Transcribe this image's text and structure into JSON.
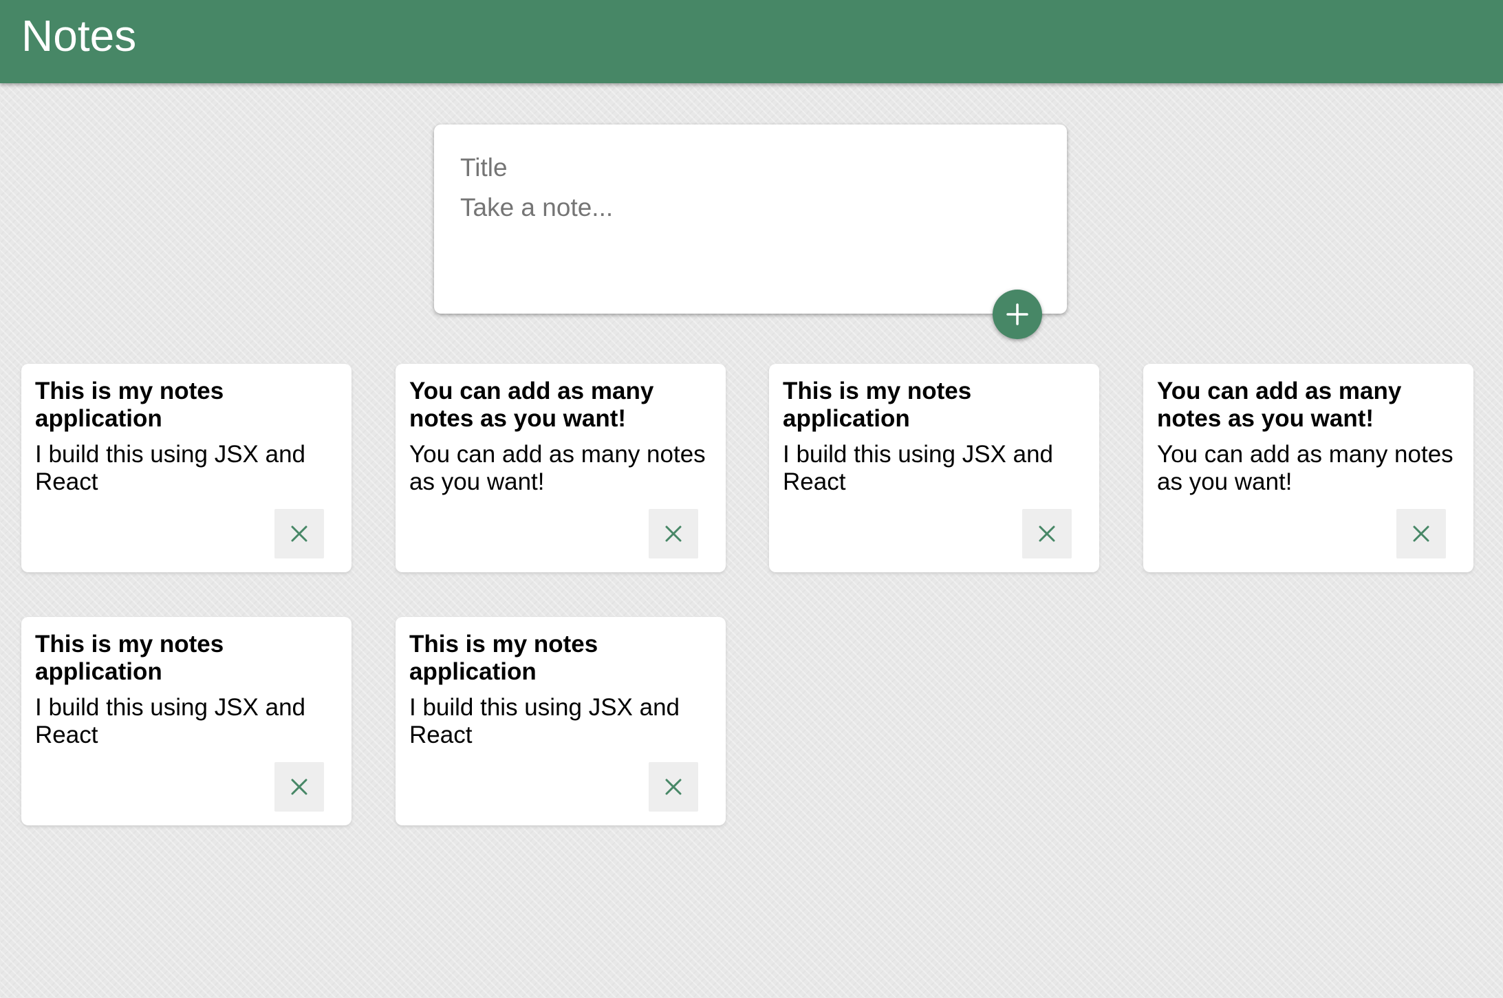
{
  "header": {
    "title": "Notes"
  },
  "create_area": {
    "title_placeholder": "Title",
    "content_placeholder": "Take a note...",
    "add_icon": "add-icon"
  },
  "notes": [
    {
      "title": "This is my notes application",
      "content": "I build this using JSX and React"
    },
    {
      "title": "You can add as many notes as you want!",
      "content": "You can add as many notes as you want!"
    },
    {
      "title": "This is my notes application",
      "content": "I build this using JSX and React"
    },
    {
      "title": "You can add as many notes as you want!",
      "content": "You can add as many notes as you want!"
    },
    {
      "title": "This is my notes application",
      "content": "I build this using JSX and React"
    },
    {
      "title": "This is my notes application",
      "content": "I build this using JSX and React"
    }
  ],
  "delete_icon": "close-icon",
  "colors": {
    "accent": "#478766",
    "background": "#e8e8e8",
    "card": "#ffffff",
    "delete_button_bg": "#eeeeee"
  }
}
